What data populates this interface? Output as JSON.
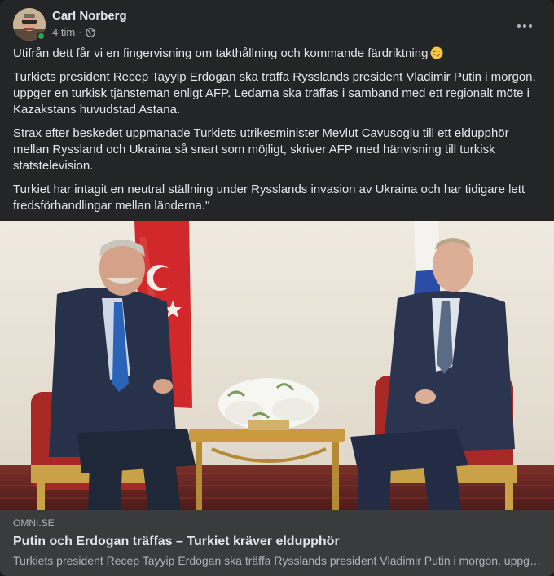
{
  "post": {
    "author": "Carl Norberg",
    "timestamp": "4 tim",
    "separator": "·",
    "audience_icon": "globe-icon",
    "online": true,
    "paragraphs": [
      "Utifrån dett får vi en fingervisning om takthållning och kommande färdriktning",
      " Turkiets president Recep Tayyip Erdogan ska träffa Rysslands president Vladimir Putin i morgon, uppger en turkisk tjänsteman enligt AFP. Ledarna ska träffas i samband med ett regionalt möte i Kazakstans huvudstad Astana.",
      "Strax efter beskedet uppmanade Turkiets utrikesminister Mevlut Cavusoglu till ett eldupphör mellan Ryssland och Ukraina så snart som möjligt, skriver AFP med hänvisning till turkisk statstelevision.",
      "Turkiet har intagit en neutral ställning under Rysslands invasion av Ukraina och har tidigare lett fredsförhandlingar mellan länderna.\""
    ],
    "emoji": "winking-tongue-emoji"
  },
  "link": {
    "domain": "OMNI.SE",
    "title": "Putin och Erdogan träffas – Turkiet kräver eldupphör",
    "description": "Turkiets president Recep Tayyip Erdogan ska träffa Rysslands president Vladimir Putin i morgon, uppger en turkisk tjänsteman enligt AFP."
  },
  "colors": {
    "card_bg": "#242526",
    "link_bg": "#3a3b3c",
    "primary_text": "#e4e6eb",
    "secondary_text": "#b0b3b8",
    "online_green": "#31a24c"
  }
}
